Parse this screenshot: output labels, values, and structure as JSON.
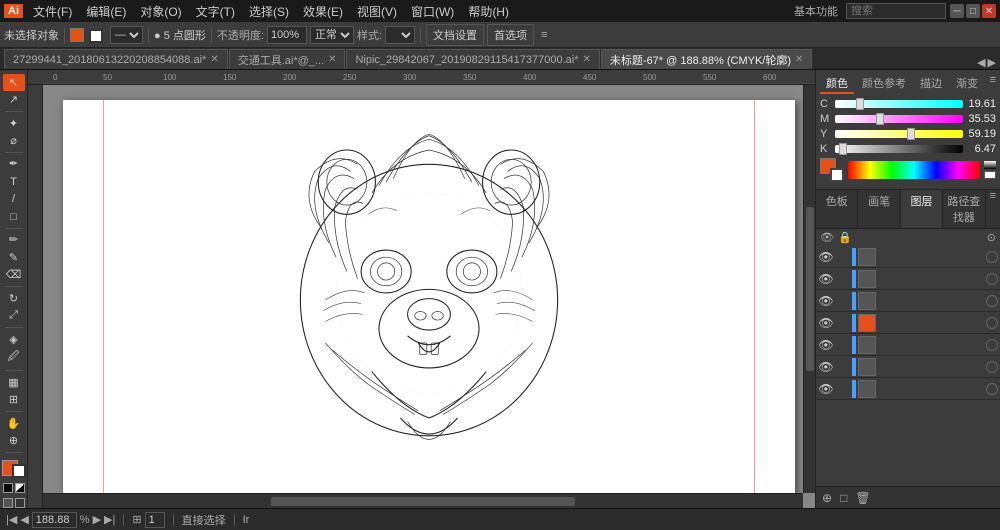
{
  "titlebar": {
    "logo": "Ai",
    "menus": [
      "文件(F)",
      "编辑(E)",
      "对象(O)",
      "文字(T)",
      "选择(S)",
      "效果(E)",
      "视图(V)",
      "窗口(W)",
      "帮助(H)"
    ],
    "workspace": "基本功能",
    "search_placeholder": "搜索",
    "win_min": "─",
    "win_max": "□",
    "win_close": "✕"
  },
  "toolbar": {
    "no_selection": "未选择对象",
    "brush_size_label": "● 5 点圆形",
    "opacity_label": "不透明度:",
    "opacity_value": "100%",
    "style_label": "样式:",
    "doc_setup": "文档设置",
    "preferences": "首选项"
  },
  "tabs": [
    {
      "label": "27299441_20180613220208854088.ai*",
      "active": false
    },
    {
      "label": "交通工具.ai*@_...",
      "active": false
    },
    {
      "label": "Nipic_29842067_20190829115417377000.ai*",
      "active": false
    },
    {
      "label": "未标题-67* @ 188.88% (CMYK/轮廓)",
      "active": true
    }
  ],
  "left_tools": [
    {
      "name": "selection-tool",
      "symbol": "↖",
      "active": true
    },
    {
      "name": "direct-selection-tool",
      "symbol": "↗"
    },
    {
      "name": "magic-wand-tool",
      "symbol": "✦"
    },
    {
      "name": "lasso-tool",
      "symbol": "⌀"
    },
    {
      "name": "pen-tool",
      "symbol": "✒"
    },
    {
      "name": "type-tool",
      "symbol": "T"
    },
    {
      "name": "line-tool",
      "symbol": "/"
    },
    {
      "name": "rect-tool",
      "symbol": "□"
    },
    {
      "name": "paintbrush-tool",
      "symbol": "✏"
    },
    {
      "name": "pencil-tool",
      "symbol": "✎"
    },
    {
      "name": "eraser-tool",
      "symbol": "◻"
    },
    {
      "name": "rotate-tool",
      "symbol": "↻"
    },
    {
      "name": "scale-tool",
      "symbol": "⤢"
    },
    {
      "name": "warp-tool",
      "symbol": "~"
    },
    {
      "name": "gradient-tool",
      "symbol": "◈"
    },
    {
      "name": "eyedropper-tool",
      "symbol": "🖉"
    },
    {
      "name": "blend-tool",
      "symbol": "⋈"
    },
    {
      "name": "symbol-tool",
      "symbol": "✿"
    },
    {
      "name": "column-graph-tool",
      "symbol": "▦"
    },
    {
      "name": "artboard-tool",
      "symbol": "⊞"
    },
    {
      "name": "slice-tool",
      "symbol": "⊡"
    },
    {
      "name": "hand-tool",
      "symbol": "✋"
    },
    {
      "name": "zoom-tool",
      "symbol": "🔍"
    }
  ],
  "color_panel": {
    "tabs": [
      "颜色",
      "颜色参考",
      "描边",
      "渐变"
    ],
    "active_tab": "颜色",
    "cmyk": {
      "c": {
        "label": "C",
        "value": 19.61,
        "percent": 0.196
      },
      "m": {
        "label": "M",
        "value": 35.53,
        "percent": 0.355
      },
      "y": {
        "label": "Y",
        "value": 59.19,
        "percent": 0.592
      },
      "k": {
        "label": "K",
        "value": 6.47,
        "percent": 0.065
      }
    },
    "fg_color": "#e8501a",
    "bg_color": "#ffffff"
  },
  "layers_panel": {
    "tabs": [
      "色板",
      "画笔",
      "图层",
      "路径查找器"
    ],
    "active_tab": "图层",
    "layers": [
      {
        "id": 1,
        "visible": true,
        "locked": false,
        "name": "",
        "selected": false,
        "has_thumb": false
      },
      {
        "id": 2,
        "visible": true,
        "locked": false,
        "name": "",
        "selected": false,
        "has_thumb": false
      },
      {
        "id": 3,
        "visible": true,
        "locked": false,
        "name": "",
        "selected": false,
        "has_thumb": false
      },
      {
        "id": 4,
        "visible": true,
        "locked": false,
        "name": "",
        "selected": false,
        "has_thumb": true
      },
      {
        "id": 5,
        "visible": true,
        "locked": false,
        "name": "",
        "selected": false,
        "has_thumb": false
      },
      {
        "id": 6,
        "visible": true,
        "locked": false,
        "name": "",
        "selected": false,
        "has_thumb": false
      },
      {
        "id": 7,
        "visible": true,
        "locked": false,
        "name": "",
        "selected": false,
        "has_thumb": false
      }
    ]
  },
  "status_bar": {
    "zoom": "188.88",
    "artboard": "1",
    "mode": "直接选择",
    "info": "Ir"
  }
}
